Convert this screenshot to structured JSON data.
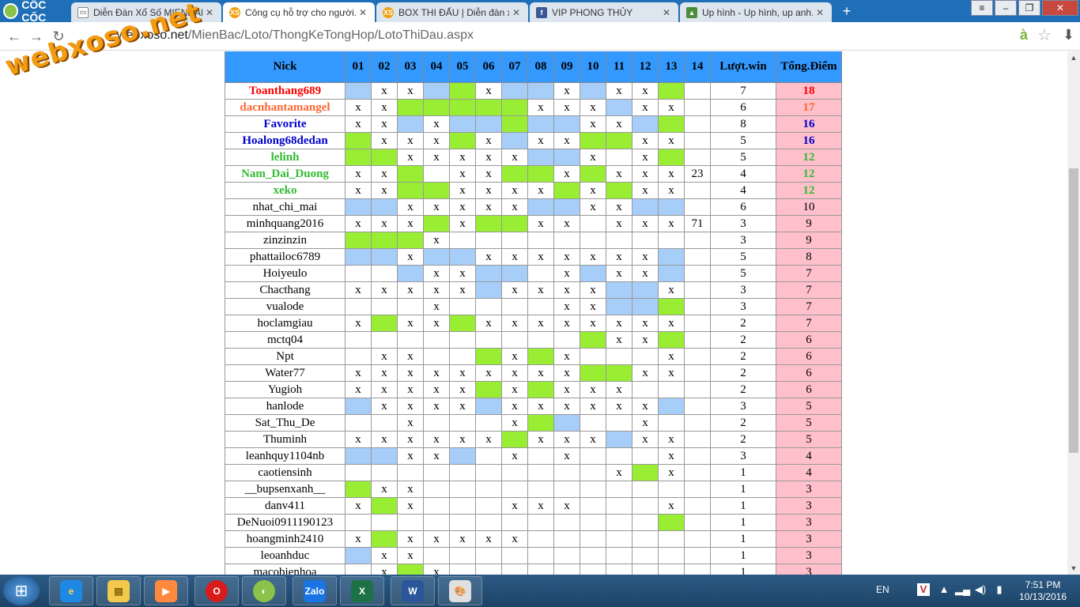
{
  "browser": {
    "brand": "CỐC CỐC",
    "tabs": [
      {
        "title": "Diễn Đàn Xổ Số MIENDAN...",
        "icon": "document-icon"
      },
      {
        "title": "Công cụ hỗ trợ cho người...",
        "icon": "xs-icon",
        "active": true
      },
      {
        "title": "BOX THI ĐẤU | Diễn đàn x...",
        "icon": "xs-icon"
      },
      {
        "title": "VIP PHONG THỦY",
        "icon": "facebook-icon"
      },
      {
        "title": "Up hình - Up hình, up anh...",
        "icon": "image-icon"
      }
    ],
    "url_host": "webxoso.net",
    "url_path": "/MienBac/Loto/ThongKeTongHop/LotoThiDau.aspx",
    "watermark": "webxoso.net"
  },
  "table": {
    "headers": [
      "Nick",
      "01",
      "02",
      "03",
      "04",
      "05",
      "06",
      "07",
      "08",
      "09",
      "10",
      "11",
      "12",
      "13",
      "14",
      "Lượt.win",
      "Tổng.Điểm"
    ],
    "rows": [
      {
        "nick": "Toanthang689",
        "style": "red",
        "cells": [
          "b",
          "x",
          "x",
          "b",
          "g",
          "x",
          "b",
          "b",
          "x",
          "b",
          "x",
          "x",
          "g",
          ""
        ],
        "win": "7",
        "pts": "18"
      },
      {
        "nick": "dacnhantamangel",
        "style": "orange",
        "cells": [
          "x",
          "x",
          "g",
          "g",
          "g",
          "g",
          "g",
          "x",
          "x",
          "x",
          "b",
          "x",
          "x",
          ""
        ],
        "win": "6",
        "pts": "17"
      },
      {
        "nick": "Favorite",
        "style": "blue",
        "cells": [
          "x",
          "x",
          "b",
          "x",
          "b",
          "b",
          "g",
          "b",
          "b",
          "x",
          "x",
          "b",
          "g",
          ""
        ],
        "win": "8",
        "pts": "16"
      },
      {
        "nick": "Hoalong68dedan",
        "style": "blue",
        "cells": [
          "g",
          "x",
          "x",
          "x",
          "g",
          "x",
          "b",
          "x",
          "x",
          "g",
          "g",
          "x",
          "x",
          ""
        ],
        "win": "5",
        "pts": "16"
      },
      {
        "nick": "lelinh",
        "style": "green",
        "cells": [
          "g",
          "g",
          "x",
          "x",
          "x",
          "x",
          "x",
          "b",
          "b",
          "x",
          "",
          "x",
          "g",
          ""
        ],
        "win": "5",
        "pts": "12"
      },
      {
        "nick": "Nam_Dai_Duong",
        "style": "green",
        "cells": [
          "x",
          "x",
          "g",
          "",
          "x",
          "x",
          "g",
          "g",
          "x",
          "g",
          "x",
          "x",
          "x",
          "23"
        ],
        "win": "4",
        "pts": "12"
      },
      {
        "nick": "xeko",
        "style": "green",
        "cells": [
          "x",
          "x",
          "g",
          "g",
          "x",
          "x",
          "x",
          "x",
          "g",
          "x",
          "g",
          "x",
          "x",
          ""
        ],
        "win": "4",
        "pts": "12"
      },
      {
        "nick": "nhat_chi_mai",
        "style": "",
        "cells": [
          "b",
          "b",
          "x",
          "x",
          "x",
          "x",
          "x",
          "b",
          "b",
          "x",
          "x",
          "b",
          "b",
          ""
        ],
        "win": "6",
        "pts": "10"
      },
      {
        "nick": "minhquang2016",
        "style": "",
        "cells": [
          "x",
          "x",
          "x",
          "g",
          "x",
          "g",
          "g",
          "x",
          "x",
          "",
          "x",
          "x",
          "x",
          "71"
        ],
        "win": "3",
        "pts": "9"
      },
      {
        "nick": "zinzinzin",
        "style": "",
        "cells": [
          "g",
          "g",
          "g",
          "x",
          "",
          "",
          "",
          "",
          "",
          "",
          "",
          "",
          "",
          ""
        ],
        "win": "3",
        "pts": "9"
      },
      {
        "nick": "phattailoc6789",
        "style": "",
        "cells": [
          "b",
          "b",
          "x",
          "b",
          "b",
          "x",
          "x",
          "x",
          "x",
          "x",
          "x",
          "x",
          "b",
          ""
        ],
        "win": "5",
        "pts": "8"
      },
      {
        "nick": "Hoiyeulo",
        "style": "",
        "cells": [
          "",
          "",
          "b",
          "x",
          "x",
          "b",
          "b",
          "",
          "x",
          "b",
          "x",
          "x",
          "b",
          ""
        ],
        "win": "5",
        "pts": "7"
      },
      {
        "nick": "Chacthang",
        "style": "",
        "cells": [
          "x",
          "x",
          "x",
          "x",
          "x",
          "b",
          "x",
          "x",
          "x",
          "x",
          "b",
          "b",
          "x",
          ""
        ],
        "win": "3",
        "pts": "7"
      },
      {
        "nick": "vualode",
        "style": "",
        "cells": [
          "",
          "",
          "",
          "x",
          "",
          "",
          "",
          "",
          "x",
          "x",
          "b",
          "b",
          "g",
          ""
        ],
        "win": "3",
        "pts": "7"
      },
      {
        "nick": "hoclamgiau",
        "style": "",
        "cells": [
          "x",
          "g",
          "x",
          "x",
          "g",
          "x",
          "x",
          "x",
          "x",
          "x",
          "x",
          "x",
          "x",
          ""
        ],
        "win": "2",
        "pts": "7"
      },
      {
        "nick": "mctq04",
        "style": "",
        "cells": [
          "",
          "",
          "",
          "",
          "",
          "",
          "",
          "",
          "",
          "g",
          "x",
          "x",
          "g",
          ""
        ],
        "win": "2",
        "pts": "6"
      },
      {
        "nick": "Npt",
        "style": "",
        "cells": [
          "",
          "x",
          "x",
          "",
          "",
          "g",
          "x",
          "g",
          "x",
          "",
          "",
          "",
          "x",
          ""
        ],
        "win": "2",
        "pts": "6"
      },
      {
        "nick": "Water77",
        "style": "",
        "cells": [
          "x",
          "x",
          "x",
          "x",
          "x",
          "x",
          "x",
          "x",
          "x",
          "g",
          "g",
          "x",
          "x",
          ""
        ],
        "win": "2",
        "pts": "6"
      },
      {
        "nick": "Yugioh",
        "style": "",
        "cells": [
          "x",
          "x",
          "x",
          "x",
          "x",
          "g",
          "x",
          "g",
          "x",
          "x",
          "x",
          "",
          "",
          ""
        ],
        "win": "2",
        "pts": "6"
      },
      {
        "nick": "hanlode",
        "style": "",
        "cells": [
          "b",
          "x",
          "x",
          "x",
          "x",
          "b",
          "x",
          "x",
          "x",
          "x",
          "x",
          "x",
          "b",
          ""
        ],
        "win": "3",
        "pts": "5"
      },
      {
        "nick": "Sat_Thu_De",
        "style": "",
        "cells": [
          "",
          "",
          "x",
          "",
          "",
          "",
          "x",
          "g",
          "b",
          "",
          "",
          "x",
          "",
          ""
        ],
        "win": "2",
        "pts": "5"
      },
      {
        "nick": "Thuminh",
        "style": "",
        "cells": [
          "x",
          "x",
          "x",
          "x",
          "x",
          "x",
          "g",
          "x",
          "x",
          "x",
          "b",
          "x",
          "x",
          ""
        ],
        "win": "2",
        "pts": "5"
      },
      {
        "nick": "leanhquy1104nb",
        "style": "",
        "cells": [
          "b",
          "b",
          "x",
          "x",
          "b",
          "",
          "x",
          "",
          "x",
          "",
          "",
          "",
          "x",
          ""
        ],
        "win": "3",
        "pts": "4"
      },
      {
        "nick": "caotiensinh",
        "style": "",
        "cells": [
          "",
          "",
          "",
          "",
          "",
          "",
          "",
          "",
          "",
          "",
          "x",
          "g",
          "x",
          ""
        ],
        "win": "1",
        "pts": "4"
      },
      {
        "nick": "__bupsenxanh__",
        "style": "",
        "cells": [
          "g",
          "x",
          "x",
          "",
          "",
          "",
          "",
          "",
          "",
          "",
          "",
          "",
          "",
          ""
        ],
        "win": "1",
        "pts": "3"
      },
      {
        "nick": "danv411",
        "style": "",
        "cells": [
          "x",
          "g",
          "x",
          "",
          "",
          "",
          "x",
          "x",
          "x",
          "",
          "",
          "",
          "x",
          ""
        ],
        "win": "1",
        "pts": "3"
      },
      {
        "nick": "DeNuoi0911190123",
        "style": "",
        "cells": [
          "",
          "",
          "",
          "",
          "",
          "",
          "",
          "",
          "",
          "",
          "",
          "",
          "g",
          ""
        ],
        "win": "1",
        "pts": "3"
      },
      {
        "nick": "hoangminh2410",
        "style": "",
        "cells": [
          "x",
          "g",
          "x",
          "x",
          "x",
          "x",
          "x",
          "",
          "",
          "",
          "",
          "",
          "",
          ""
        ],
        "win": "1",
        "pts": "3"
      },
      {
        "nick": "leoanhduc",
        "style": "",
        "cells": [
          "b",
          "x",
          "x",
          "",
          "",
          "",
          "",
          "",
          "",
          "",
          "",
          "",
          "",
          ""
        ],
        "win": "1",
        "pts": "3"
      },
      {
        "nick": "macobienhoa",
        "style": "",
        "cells": [
          "",
          "x",
          "g",
          "x",
          "",
          "",
          "",
          "",
          "",
          "",
          "",
          "",
          "",
          ""
        ],
        "win": "1",
        "pts": "3"
      }
    ]
  },
  "taskbar": {
    "apps": [
      "IE",
      "Explorer",
      "Media",
      "Opera",
      "Coc Coc",
      "Zalo",
      "Excel",
      "Word",
      "Paint"
    ],
    "lang": "EN",
    "time": "7:51 PM",
    "date": "10/13/2016"
  }
}
